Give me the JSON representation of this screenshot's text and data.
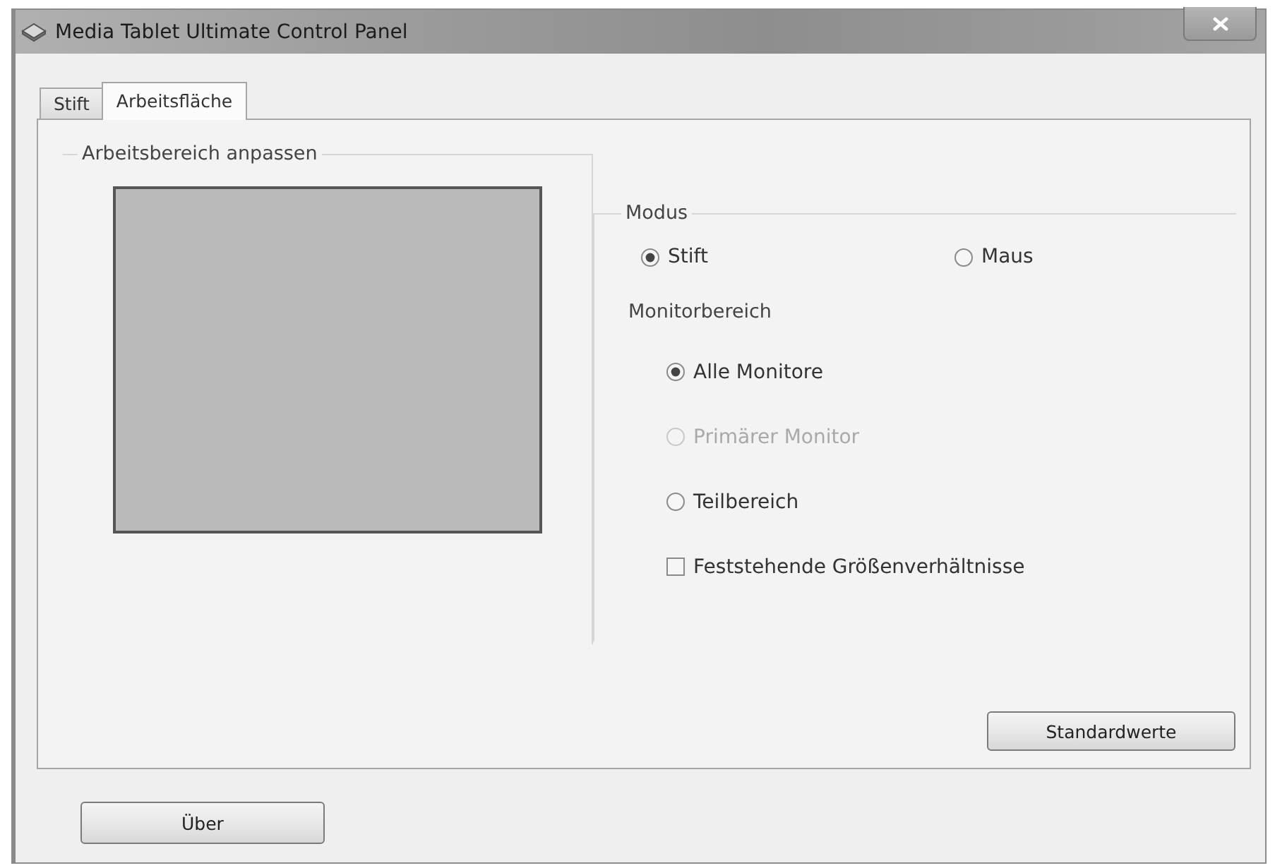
{
  "window": {
    "title": "Media Tablet Ultimate Control Panel"
  },
  "tabs": [
    {
      "label": "Stift",
      "selected": false
    },
    {
      "label": "Arbeitsfläche",
      "selected": true
    }
  ],
  "work_area": {
    "title": "Arbeitsbereich anpassen"
  },
  "mode": {
    "title": "Modus",
    "options": [
      {
        "label": "Stift",
        "selected": true
      },
      {
        "label": "Maus",
        "selected": false
      }
    ]
  },
  "monitor_area": {
    "title": "Monitorbereich",
    "options": [
      {
        "label": "Alle Monitore",
        "selected": true,
        "disabled": false
      },
      {
        "label": "Primärer Monitor",
        "selected": false,
        "disabled": true
      },
      {
        "label": "Teilbereich",
        "selected": false,
        "disabled": false
      }
    ]
  },
  "fixed_ratio": {
    "label": "Feststehende Größenverhältnisse",
    "checked": false
  },
  "defaults_button": {
    "label": "Standardwerte"
  },
  "about_button": {
    "label": "Über"
  }
}
